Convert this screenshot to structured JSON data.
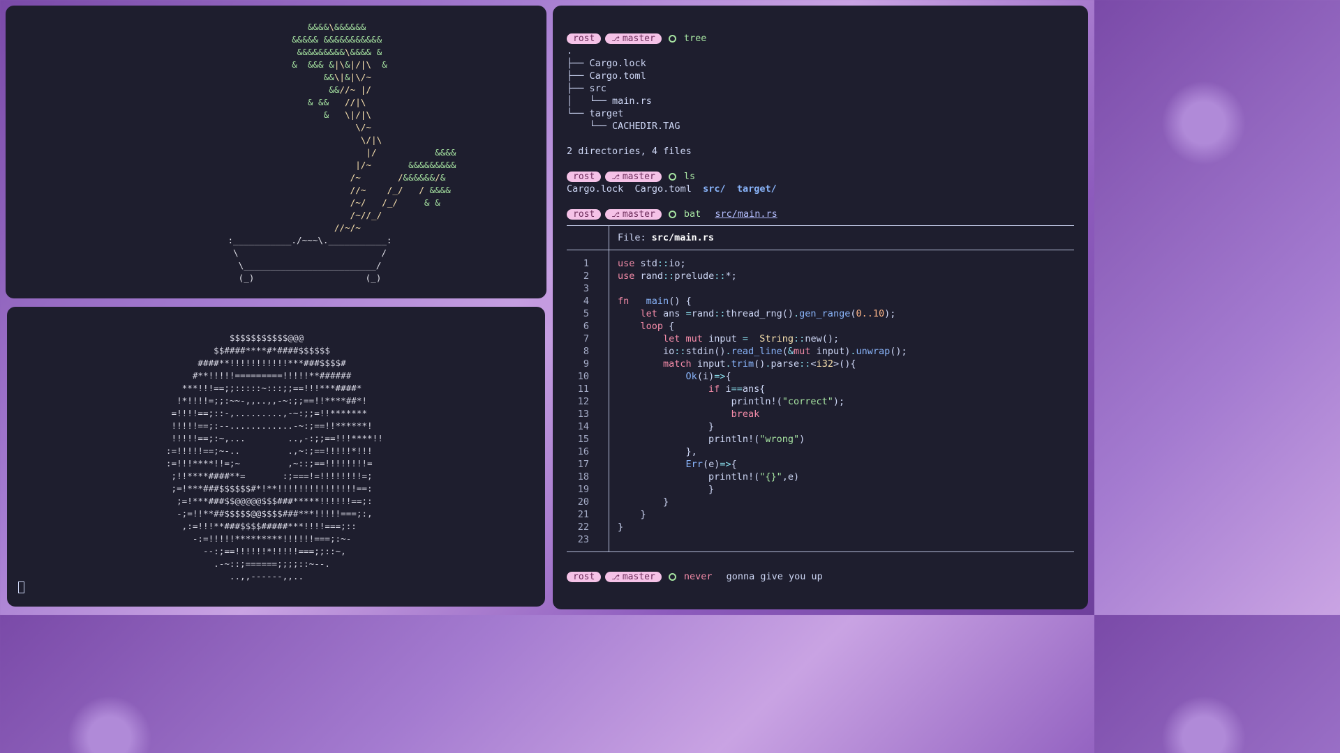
{
  "bonsai_lines": [
    "                                                         &&&&\\&&&&&&",
    "                                                      &&&&& &&&&&&&&&&&",
    "                                                       &&&&&&&&&\\&&&& &",
    "                                                      &  &&& &|\\&|/|\\  &",
    "                                                            &&\\|&|\\/~",
    "                                                             &&//~ |/",
    "                                                         & &&   //|\\",
    "                                                            &   \\|/|\\",
    "                                                                  \\/~",
    "                                                                   \\/|\\",
    "                                                                    |/           &&&&",
    "                                                                  |/~       &&&&&&&&&",
    "                                                                 /~       /&&&&&&/&",
    "                                                                 //~    /_/   / &&&&",
    "                                                                 /~/   /_/     & &",
    "                                                                 /~//_/",
    "                                                              //~/~",
    "                                          :___________./~~~\\.___________:",
    "                                           \\                           /",
    "                                            \\_________________________/",
    "                                            (_)                     (_)"
  ],
  "moon_lines": [
    "                 $$$$$$$$$$$@@@",
    "              $$####****#*####$$$$$$",
    "           ####**!!!!!!!!!!!***###$$$$#",
    "          #**!!!!!=========!!!!!**######",
    "        ***!!!==;;:::::~:::;;==!!!***####*",
    "       !*!!!!=;;:~~-,,..,,-~:;;==!!****##*!",
    "      =!!!!==;::-,.........,-~:;;=!!*******",
    "      !!!!!==;:--............-~:;==!!******!",
    "      !!!!!==;:~,...        ..,-:;;==!!!****!!",
    "     :=!!!!!==;~-..         .,~:;==!!!!!*!!!",
    "     :=!!!****!!=;~         ,~::;==!!!!!!!!=",
    "      ;!!****####**=       :;===!=!!!!!!!!=;",
    "      ;=!***###$$$$$$#*!**!!!!!!!!!!!!!!!==:",
    "       ;=!***###$$@@@@@$$$###*****!!!!!!==;:",
    "       -;=!!**##$$$$$@@$$$$###***!!!!!===;:,",
    "        ,:=!!!**###$$$$#####***!!!!===;::",
    "          -:=!!!!!*********!!!!!!===;:~-",
    "            --:;==!!!!!!*!!!!!===;;::~,",
    "              .-~::;======;;;;::~--.",
    "                 ..,,------,,.."
  ],
  "term": {
    "prompt_dir": "rost",
    "prompt_branch": "master",
    "branch_icon": "branch-icon",
    "cmd1": "tree",
    "tree_lines": [
      ".",
      "├── Cargo.lock",
      "├── Cargo.toml",
      "├── src",
      "│   └── main.rs",
      "└── target",
      "    └── CACHEDIR.TAG"
    ],
    "tree_summary": "2 directories, 4 files",
    "cmd2": "ls",
    "ls_files": [
      "Cargo.lock",
      "Cargo.toml"
    ],
    "ls_dirs": [
      "src/",
      "target/"
    ],
    "cmd3": "bat",
    "cmd3_arg": "src/main.rs",
    "bat_file_label": "File:",
    "bat_file_name": "src/main.rs",
    "cmd4_red": "never",
    "cmd4_rest": "gonna give you up"
  },
  "code_lines": [
    [
      [
        "kw2",
        "use"
      ],
      [
        "",
        "std"
      ],
      [
        "op",
        "::"
      ],
      [
        "",
        "io;"
      ]
    ],
    [
      [
        "kw2",
        "use"
      ],
      [
        "",
        "rand"
      ],
      [
        "op",
        "::"
      ],
      [
        "",
        "prelude"
      ],
      [
        "op",
        "::"
      ],
      [
        "",
        "*;"
      ]
    ],
    [],
    [
      [
        "kw2",
        "fn"
      ],
      [
        "",
        "  "
      ],
      [
        "fnc",
        "main"
      ],
      [
        "",
        "() {"
      ]
    ],
    [
      [
        "",
        "    "
      ],
      [
        "kw2",
        "let"
      ],
      [
        "",
        "ans "
      ],
      [
        "op",
        "="
      ],
      [
        "",
        "rand"
      ],
      [
        "op",
        "::"
      ],
      [
        "",
        "thread_rng"
      ],
      [
        "",
        "()"
      ],
      [
        "op",
        "."
      ],
      [
        "fnc",
        "gen_range"
      ],
      [
        "",
        "("
      ],
      [
        "num",
        "0..10"
      ],
      [
        "",
        ");"
      ]
    ],
    [
      [
        "",
        "    "
      ],
      [
        "kw2",
        "loop"
      ],
      [
        "",
        "{"
      ]
    ],
    [
      [
        "",
        "        "
      ],
      [
        "kw2",
        "let mut"
      ],
      [
        "",
        "input "
      ],
      [
        "op",
        "="
      ],
      [
        "",
        "  "
      ],
      [
        "ty",
        "String"
      ],
      [
        "op",
        "::"
      ],
      [
        "",
        "new"
      ],
      [
        "",
        "();"
      ]
    ],
    [
      [
        "",
        "        "
      ],
      [
        "",
        "io"
      ],
      [
        "op",
        "::"
      ],
      [
        "",
        "stdin"
      ],
      [
        "",
        "()"
      ],
      [
        "op",
        "."
      ],
      [
        "fnc",
        "read_line"
      ],
      [
        "",
        "("
      ],
      [
        "op",
        "&"
      ],
      [
        "kw2",
        "mut"
      ],
      [
        "",
        "input)"
      ],
      [
        "op",
        "."
      ],
      [
        "fnc",
        "unwrap"
      ],
      [
        "",
        "();"
      ]
    ],
    [
      [
        "",
        "        "
      ],
      [
        "kw2",
        "match"
      ],
      [
        "",
        "input"
      ],
      [
        "op",
        "."
      ],
      [
        "fnc",
        "trim"
      ],
      [
        "",
        "()"
      ],
      [
        "op",
        "."
      ],
      [
        "",
        "parse"
      ],
      [
        "op",
        "::"
      ],
      [
        "",
        "<"
      ],
      [
        "ty",
        "i32"
      ],
      [
        "",
        "&gt;(){"
      ]
    ],
    [
      [
        "",
        "            "
      ],
      [
        "fnc",
        "Ok"
      ],
      [
        "",
        "(i)"
      ],
      [
        "op",
        "=>"
      ],
      [
        "",
        "{"
      ]
    ],
    [
      [
        "",
        "                "
      ],
      [
        "kw2",
        "if"
      ],
      [
        "",
        "i"
      ],
      [
        "op",
        "=="
      ],
      [
        "",
        "ans{"
      ]
    ],
    [
      [
        "",
        "                    "
      ],
      [
        "",
        "println!"
      ],
      [
        "",
        "("
      ],
      [
        "str",
        "\"correct\""
      ],
      [
        "",
        ");"
      ]
    ],
    [
      [
        "",
        "                    "
      ],
      [
        "kw2",
        "break"
      ]
    ],
    [
      [
        "",
        "                }"
      ]
    ],
    [
      [
        "",
        "                "
      ],
      [
        "",
        "println!"
      ],
      [
        "",
        "("
      ],
      [
        "str",
        "\"wrong\""
      ],
      [
        "",
        ")"
      ]
    ],
    [
      [
        "",
        "            },"
      ]
    ],
    [
      [
        "",
        "            "
      ],
      [
        "fnc",
        "Err"
      ],
      [
        "",
        "(e)"
      ],
      [
        "op",
        "=>"
      ],
      [
        "",
        "{"
      ]
    ],
    [
      [
        "",
        "                "
      ],
      [
        "",
        "println!"
      ],
      [
        "",
        "("
      ],
      [
        "str",
        "\"{}\""
      ],
      [
        "",
        ",e)"
      ]
    ],
    [
      [
        "",
        "                }"
      ]
    ],
    [
      [
        "",
        "        }"
      ]
    ],
    [
      [
        "",
        "    }"
      ]
    ],
    [
      [
        "",
        "}"
      ]
    ],
    []
  ]
}
